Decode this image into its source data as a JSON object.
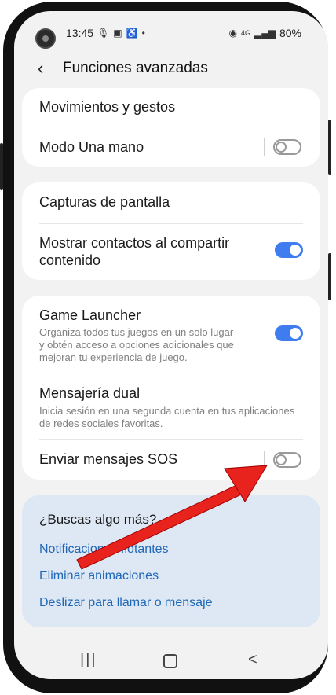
{
  "status_bar": {
    "time": "13:45",
    "left_icons": [
      "microphone-icon",
      "image-icon",
      "accessibility-icon",
      "dot-icon"
    ],
    "right_icons": [
      "hotspot-icon",
      "4g-icon",
      "signal-icon"
    ],
    "battery": "80%"
  },
  "header": {
    "title": "Funciones avanzadas"
  },
  "group1": [
    {
      "label": "Movimientos y gestos"
    },
    {
      "label": "Modo Una mano",
      "toggle": false
    }
  ],
  "group2": [
    {
      "label": "Capturas de pantalla"
    },
    {
      "label": "Mostrar contactos al compartir contenido",
      "line1": "Mostrar contactos al compartir",
      "line2": "contenido",
      "toggle": true
    }
  ],
  "group3": [
    {
      "label": "Game Launcher",
      "desc1": "Organiza todos tus juegos en un solo lugar",
      "desc2": "y obtén acceso a opciones adicionales que",
      "desc3": "mejoran tu experiencia de juego.",
      "toggle": true
    },
    {
      "label": "Mensajería dual",
      "desc1": "Inicia sesión en una segunda cuenta en tus aplicaciones",
      "desc2": "de redes sociales favoritas."
    },
    {
      "label": "Enviar mensajes SOS",
      "toggle": false
    }
  ],
  "more": {
    "heading": "¿Buscas algo más?",
    "links": [
      "Notificaciones flotantes",
      "Eliminar animaciones",
      "Deslizar para llamar o mensaje"
    ]
  },
  "nav": {
    "recent": "|||",
    "back": "<"
  },
  "colors": {
    "accent": "#3e7cf0",
    "link": "#1f66b6",
    "arrow": "#e8231e",
    "panel": "#dde8f4"
  }
}
